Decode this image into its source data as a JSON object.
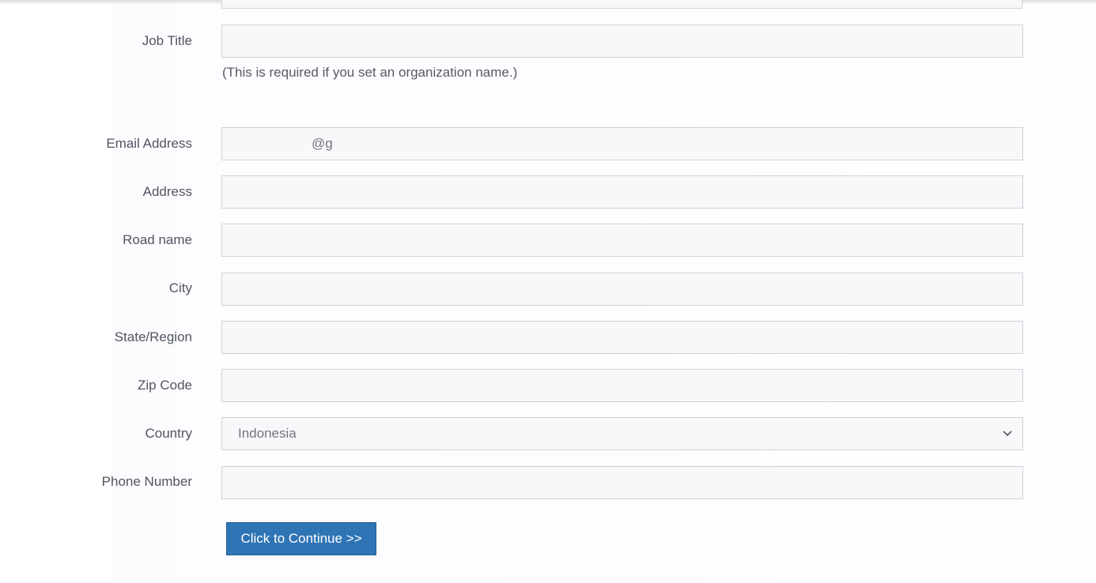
{
  "form": {
    "job_title": {
      "label": "Job Title",
      "value": "",
      "help": "(This is required if you set an organization name.)"
    },
    "email": {
      "label": "Email Address",
      "value": "@g"
    },
    "address": {
      "label": "Address",
      "value": ""
    },
    "road_name": {
      "label": "Road name",
      "value": ""
    },
    "city": {
      "label": "City",
      "value": ""
    },
    "state_region": {
      "label": "State/Region",
      "value": ""
    },
    "zip_code": {
      "label": "Zip Code",
      "value": ""
    },
    "country": {
      "label": "Country",
      "selected": "Indonesia"
    },
    "phone_number": {
      "label": "Phone Number",
      "value": ""
    },
    "continue_label": "Click to Continue >>"
  },
  "icons": {
    "country_select_arrow": "chevron-down-icon"
  },
  "colors": {
    "button_bg": "#2f74b5",
    "field_bg": "#f8f8fb",
    "field_border": "#d2d2d6",
    "label_text": "#4f5562"
  }
}
